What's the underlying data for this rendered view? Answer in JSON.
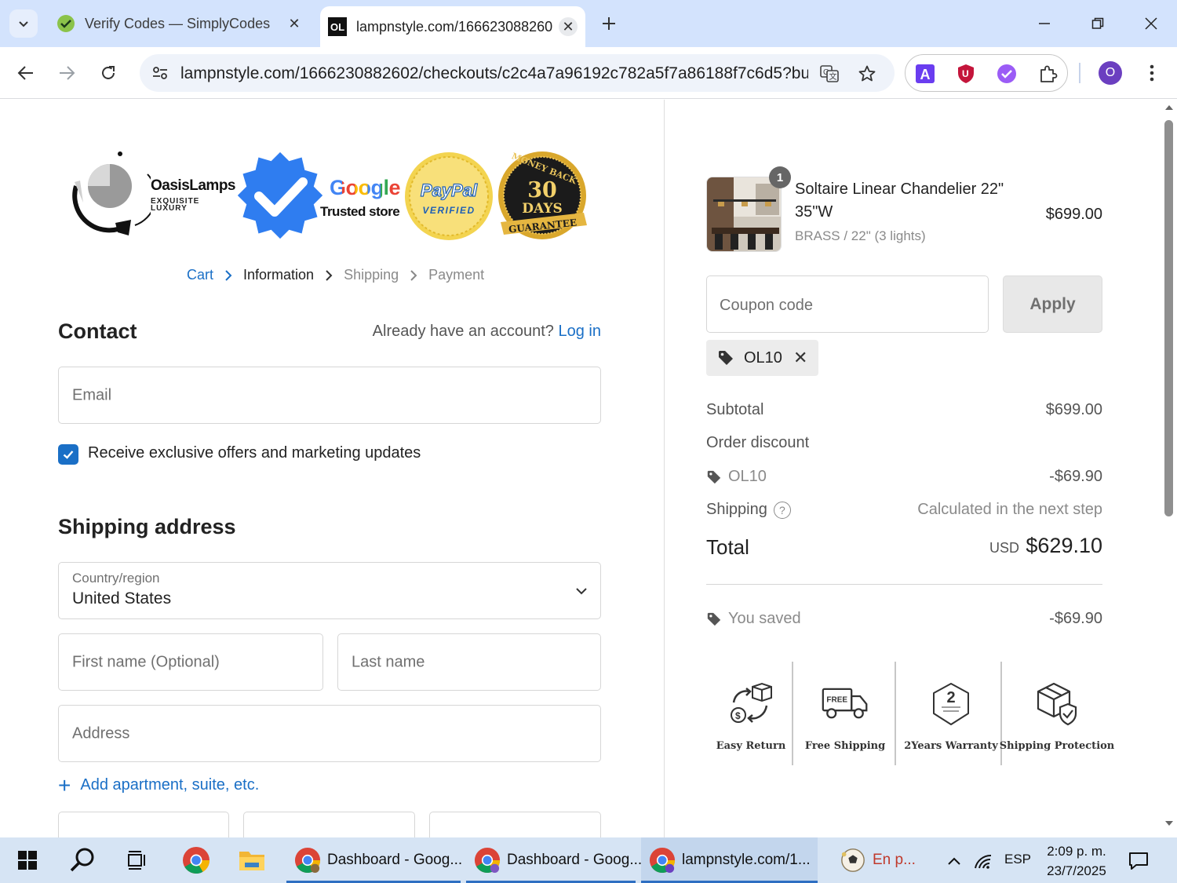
{
  "browser": {
    "tabs": [
      {
        "title": "Verify Codes — SimplyCodes",
        "active": false
      },
      {
        "title": "lampnstyle.com/166623088260",
        "active": true
      }
    ],
    "url": "lampnstyle.com/1666230882602/checkouts/c2c4a7a96192c782a5f7a86188f7c6d5?buy...",
    "profile_initial": "O",
    "active_tab_favicon_text": "OL"
  },
  "checkout": {
    "brand": {
      "name": "OasisLamps",
      "tagline": "EXQUISITE LUXURY"
    },
    "badges": {
      "google_word": "Google",
      "google_trusted": "Trusted store",
      "paypal_word": "PayPal",
      "paypal_verified": "VERIFIED",
      "money_back_top": "MONEY BACK",
      "money_back_number": "30",
      "money_back_days": "DAYS",
      "money_back_bottom": "GUARANTEE"
    },
    "breadcrumb": [
      "Cart",
      "Information",
      "Shipping",
      "Payment"
    ],
    "contact": {
      "heading": "Contact",
      "account_prompt": "Already have an account?",
      "login_link": "Log in",
      "email_placeholder": "Email",
      "offers_label": "Receive exclusive offers and marketing updates",
      "offers_checked": true
    },
    "shipping": {
      "heading": "Shipping address",
      "country_label": "Country/region",
      "country_value": "United States",
      "first_name_placeholder": "First name (Optional)",
      "last_name_placeholder": "Last name",
      "address_placeholder": "Address",
      "add_apartment": "Add apartment, suite, etc."
    }
  },
  "summary": {
    "product": {
      "quantity": "1",
      "name": "Soltaire Linear Chandelier 22\" 35\"W",
      "variant": "BRASS / 22\" (3 lights)",
      "price": "$699.00"
    },
    "coupon_placeholder": "Coupon code",
    "apply_label": "Apply",
    "applied_code": "OL10",
    "subtotal_label": "Subtotal",
    "subtotal_value": "$699.00",
    "order_discount_label": "Order discount",
    "discount_code": "OL10",
    "discount_value": "-$69.90",
    "shipping_label": "Shipping",
    "shipping_value": "Calculated in the next step",
    "total_label": "Total",
    "total_currency": "USD",
    "total_value": "$629.10",
    "saved_label": "You saved",
    "saved_value": "-$69.90",
    "trust_badges": [
      {
        "label": "Easy Return",
        "icon": "easy-return-icon"
      },
      {
        "label": "Free Shipping",
        "icon": "free-shipping-truck-icon"
      },
      {
        "label": "2Years Warranty",
        "icon": "warranty-icon"
      },
      {
        "label": "Shipping Protection",
        "icon": "shipping-protection-icon"
      }
    ],
    "free_text": "FREE",
    "warranty_number": "2"
  },
  "taskbar": {
    "apps": [
      {
        "label": "Dashboard - Goog..."
      },
      {
        "label": "Dashboard - Goog..."
      },
      {
        "label": "lampnstyle.com/1..."
      },
      {
        "label": "En p..."
      }
    ],
    "language": "ESP",
    "time": "2:09 p. m.",
    "date": "23/7/2025"
  },
  "colors": {
    "accent": "#1a6fc6",
    "tabstrip": "#d3e3fd",
    "taskbar": "#d6e4f4"
  }
}
